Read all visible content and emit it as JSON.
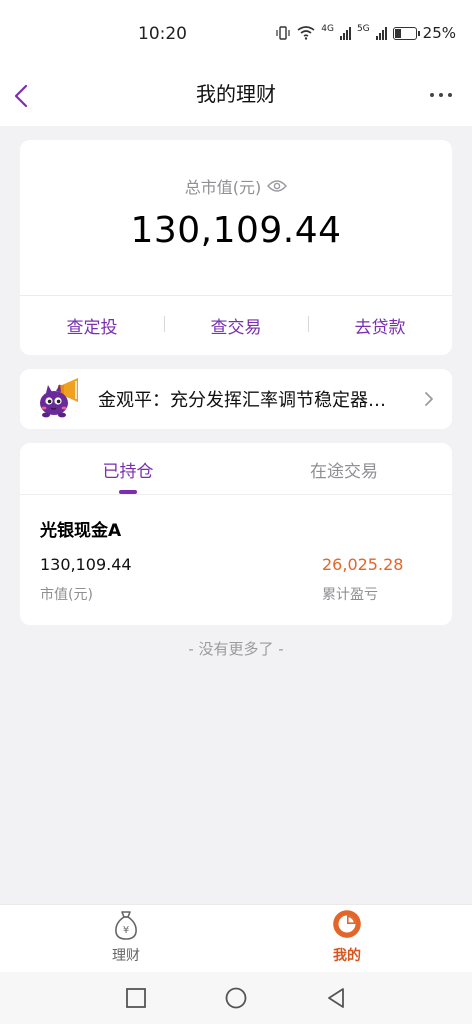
{
  "status_bar": {
    "time": "10:20",
    "network_4g": "4G",
    "network_5g": "5G",
    "battery_percent": "25%",
    "battery_level": 0.25
  },
  "header": {
    "title": "我的理财",
    "back_icon": "chevron-left-icon",
    "more_icon": "more-horizontal-icon"
  },
  "summary": {
    "label": "总市值(元)",
    "value": "130,109.44",
    "actions": [
      "查定投",
      "查交易",
      "去贷款"
    ]
  },
  "news": {
    "text": "金观平：充分发挥汇率调节稳定器…"
  },
  "holdings": {
    "tabs": [
      "已持仓",
      "在途交易"
    ],
    "active_tab": 0,
    "fund": {
      "name": "光银现金A",
      "market_value": "130,109.44",
      "market_value_label": "市值(元)",
      "profit_loss": "26,025.28",
      "profit_loss_label": "累计盈亏"
    }
  },
  "footer_note": "- 没有更多了 -",
  "bottom_nav": {
    "items": [
      "理财",
      "我的"
    ],
    "active": 1
  },
  "colors": {
    "accent_purple": "#7a2fb0",
    "accent_orange": "#e0672a"
  }
}
